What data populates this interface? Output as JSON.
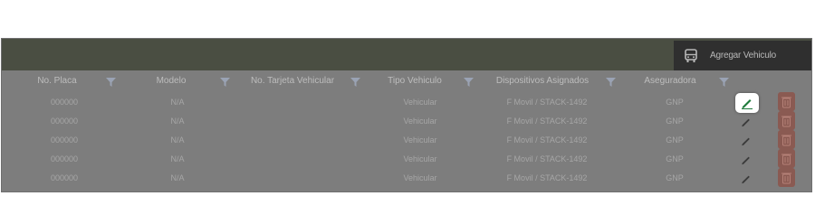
{
  "toolbar": {
    "add_label": "Agregar Vehiculo"
  },
  "columns": [
    {
      "label": "No. Placa"
    },
    {
      "label": "Modelo"
    },
    {
      "label": "No. Tarjeta Vehicular"
    },
    {
      "label": "Tipo Vehiculo"
    },
    {
      "label": "Dispositivos Asignados"
    },
    {
      "label": "Aseguradora"
    }
  ],
  "rows": [
    {
      "placa": "000000",
      "modelo": "N/A",
      "tarjeta": "",
      "tipo": "Vehicular",
      "dispositivos": "F Movil / STACK-1492",
      "aseguradora": "GNP"
    },
    {
      "placa": "000000",
      "modelo": "N/A",
      "tarjeta": "",
      "tipo": "Vehicular",
      "dispositivos": "F Movil / STACK-1492",
      "aseguradora": "GNP"
    },
    {
      "placa": "000000",
      "modelo": "N/A",
      "tarjeta": "",
      "tipo": "Vehicular",
      "dispositivos": "F Movil / STACK-1492",
      "aseguradora": "GNP"
    },
    {
      "placa": "000000",
      "modelo": "N/A",
      "tarjeta": "",
      "tipo": "Vehicular",
      "dispositivos": "F Movil / STACK-1492",
      "aseguradora": "GNP"
    },
    {
      "placa": "000000",
      "modelo": "N/A",
      "tarjeta": "",
      "tipo": "Vehicular",
      "dispositivos": "F Movil / STACK-1492",
      "aseguradora": "GNP"
    }
  ],
  "icons": {
    "add": "bus-icon",
    "filter": "filter-icon",
    "edit": "pencil-icon",
    "delete": "trash-icon"
  },
  "colors": {
    "toolbar": "#4a4e42",
    "overlay": "#7d7d7d",
    "edit_green": "#1e7a3a",
    "delete": "#8a5a52"
  }
}
